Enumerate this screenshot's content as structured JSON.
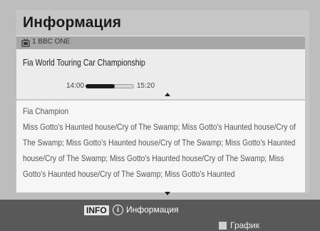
{
  "window": {
    "title": "Информация"
  },
  "channel": {
    "icon": "tv-icon",
    "name": "1 BBC ONE"
  },
  "program": {
    "title": "Fia World Touring Car Championship",
    "start_time": "14:00",
    "end_time": "15:20",
    "progress_fraction": 0.6
  },
  "description": {
    "genre": "Fia Champion",
    "text": "Miss Gotto's Haunted house/Cry of The Swamp; Miss Gotto's Haunted house/Cry of The Swamp; Miss Gotto's Haunted house/Cry of The Swamp; Miss Gotto's Haunted house/Cry of The Swamp; Miss Gotto's Haunted house/Cry of The Swamp; Miss Gotto's Haunted house/Cry of The Swamp; Miss Gotto's Haunted"
  },
  "footer": {
    "info_key": "INFO",
    "info_icon": "i",
    "info_label": "Информация",
    "graph_label": "График"
  }
}
